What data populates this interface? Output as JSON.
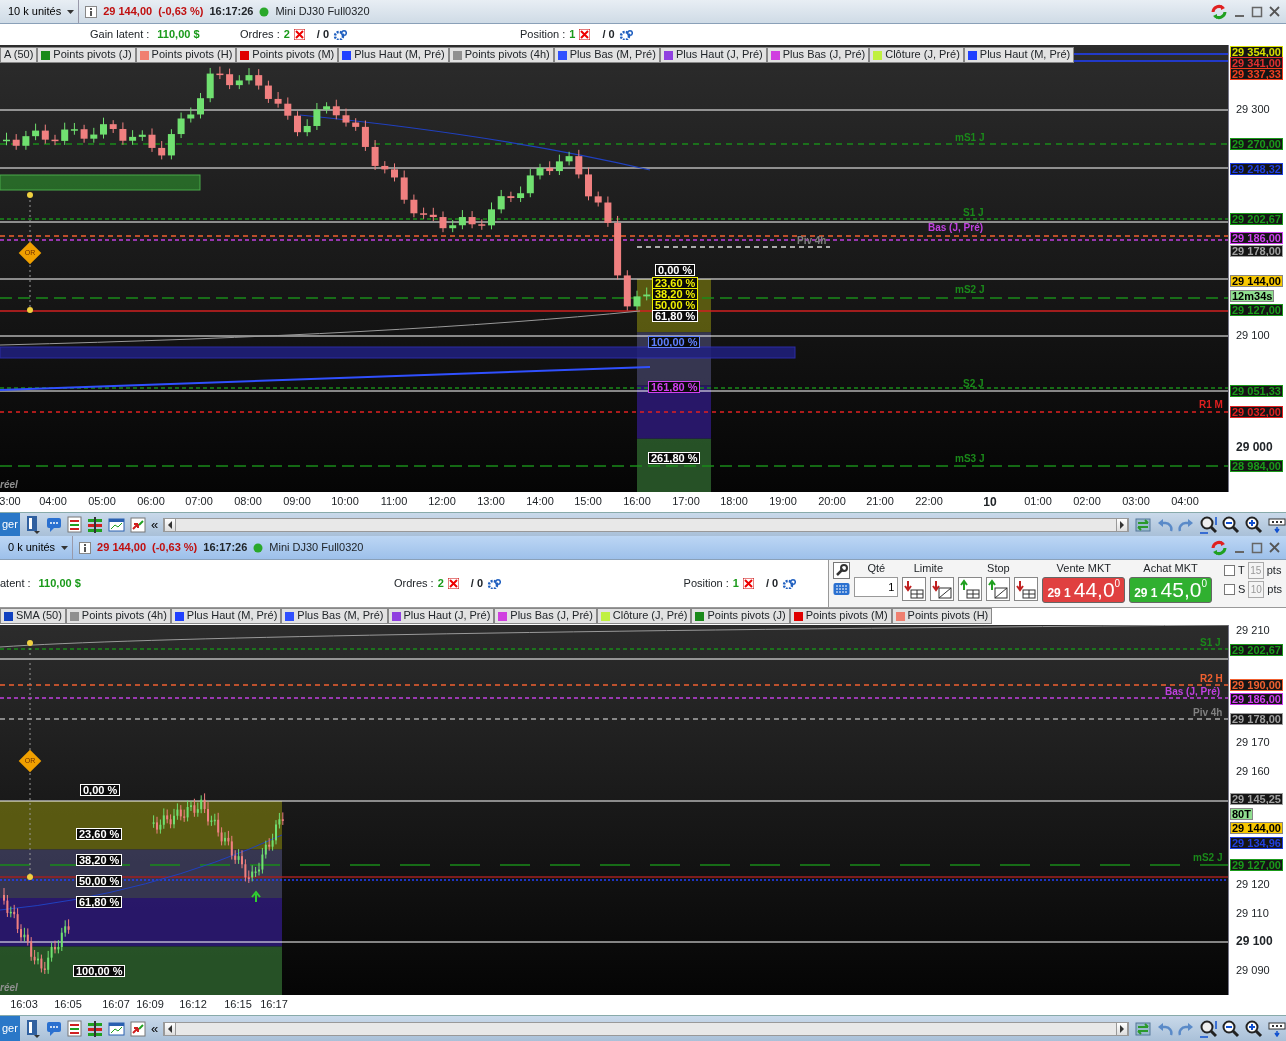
{
  "panels": [
    {
      "title_bar": {
        "units": "10 k unités",
        "price": "29 144,00",
        "change": "(-0,63 %)",
        "time": "16:17:26",
        "instrument": "Mini DJ30 Full0320"
      },
      "info": {
        "gain_label": "Gain latent :",
        "gain_value": "110,00 $",
        "orders_label": "Ordres :",
        "orders_count": "2",
        "orders_pending": "/ 0",
        "position_label": "Position :",
        "position_count": "1",
        "position_pending": "/ 0"
      },
      "legend": [
        {
          "label": "A (50)"
        },
        {
          "label": "Points pivots (J)",
          "color": "#1a8a1a"
        },
        {
          "label": "Points pivots (H)",
          "color": "#f08070"
        },
        {
          "label": "Points pivots (M)",
          "color": "#e00000"
        },
        {
          "label": "Plus Haut (M, Pré)",
          "color": "#2040ff"
        },
        {
          "label": "Points pivots (4h)",
          "color": "#909090"
        },
        {
          "label": "Plus Bas (M, Pré)",
          "color": "#3050ff"
        },
        {
          "label": "Plus Haut (J, Pré)",
          "color": "#9040e0"
        },
        {
          "label": "Plus Bas (J, Pré)",
          "color": "#d040e0"
        },
        {
          "label": "Clôture (J, Pré)",
          "color": "#c0f040"
        },
        {
          "label": "Plus Haut (M, Pré)",
          "color": "#2040ff"
        }
      ],
      "axis": [
        {
          "text": "29 354,00",
          "kind": "tag",
          "color": "#d8e000"
        },
        {
          "text": "29 341,00",
          "kind": "tag",
          "color": "#e03030"
        },
        {
          "text": "29 337,33",
          "kind": "tag",
          "color": "#f04020"
        },
        {
          "text": "29 300",
          "kind": "tick"
        },
        {
          "text": "29 270,00",
          "kind": "tag",
          "color": "#1a9a1a"
        },
        {
          "text": "29 248,32",
          "kind": "tag",
          "color": "#2040e0"
        },
        {
          "text": "29 202,67",
          "kind": "tag",
          "color": "#1a9a1a"
        },
        {
          "text": "29 186,00",
          "kind": "tag",
          "color": "#d040f0"
        },
        {
          "text": "29 178,00",
          "kind": "tag",
          "color": "#a0a0a0"
        },
        {
          "text": "29 144,00",
          "kind": "price"
        },
        {
          "text": "12m34s",
          "kind": "timer"
        },
        {
          "text": "29 127,00",
          "kind": "tag",
          "color": "#1a9a1a"
        },
        {
          "text": "29 100",
          "kind": "tick"
        },
        {
          "text": "29 051,33",
          "kind": "tag",
          "color": "#1a9a1a"
        },
        {
          "text": "29 032,00",
          "kind": "tag",
          "color": "#e02020"
        },
        {
          "text": "29 000",
          "kind": "major"
        },
        {
          "text": "28 984,00",
          "kind": "tag",
          "color": "#1a9a1a"
        }
      ],
      "chart_labels": [
        {
          "text": "mS1 J",
          "color": "#1a8a1a"
        },
        {
          "text": "S1 J",
          "color": "#1a8a1a"
        },
        {
          "text": "Bas (J, Pré)",
          "color": "#c040e0"
        },
        {
          "text": "Piv 4h",
          "color": "#808080"
        },
        {
          "text": "mS2 J",
          "color": "#1a8a1a"
        },
        {
          "text": "S2 J",
          "color": "#1a8a1a"
        },
        {
          "text": "R1 M",
          "color": "#e02020"
        },
        {
          "text": "mS3 J",
          "color": "#1a8a1a"
        },
        {
          "text": "réel",
          "color": "#909090"
        }
      ],
      "marker": "OR",
      "fib": [
        {
          "text": "0,00 %",
          "color": "#ffffff"
        },
        {
          "text": "23,60 %",
          "color": "#f0f000"
        },
        {
          "text": "38,20 %",
          "color": "#f0f000"
        },
        {
          "text": "50,00 %",
          "color": "#f0f000"
        },
        {
          "text": "61,80 %",
          "color": "#ffffff"
        },
        {
          "text": "100,00 %",
          "color": "#6080ff"
        },
        {
          "text": "161,80 %",
          "color": "#d040f0"
        },
        {
          "text": "261,80 %",
          "color": "#ffffff"
        }
      ],
      "times": [
        {
          "text": "3:00"
        },
        {
          "text": "04:00"
        },
        {
          "text": "05:00"
        },
        {
          "text": "06:00"
        },
        {
          "text": "07:00"
        },
        {
          "text": "08:00"
        },
        {
          "text": "09:00"
        },
        {
          "text": "10:00"
        },
        {
          "text": "11:00"
        },
        {
          "text": "12:00"
        },
        {
          "text": "13:00"
        },
        {
          "text": "14:00"
        },
        {
          "text": "15:00"
        },
        {
          "text": "16:00"
        },
        {
          "text": "17:00"
        },
        {
          "text": "18:00"
        },
        {
          "text": "19:00"
        },
        {
          "text": "20:00"
        },
        {
          "text": "21:00"
        },
        {
          "text": "22:00"
        },
        {
          "text": "10",
          "bold": true
        },
        {
          "text": "01:00"
        },
        {
          "text": "02:00"
        },
        {
          "text": "03:00"
        },
        {
          "text": "04:00"
        }
      ],
      "toolbar": {
        "cut_label": "ger",
        "collapse": "«"
      }
    },
    {
      "title_bar": {
        "units": "0 k unités",
        "price": "29 144,00",
        "change": "(-0,63 %)",
        "time": "16:17:26",
        "instrument": "Mini DJ30 Full0320"
      },
      "info": {
        "gain_label": "atent :",
        "gain_value": "110,00 $",
        "orders_label": "Ordres :",
        "orders_count": "2",
        "orders_pending": "/ 0",
        "position_label": "Position :",
        "position_count": "1",
        "position_pending": "/ 0"
      },
      "order_ticket": {
        "qty_label": "Qté",
        "qty": "1",
        "limit_label": "Limite",
        "stop_label": "Stop",
        "sell_label": "Vente MKT",
        "sell_prefix": "29 1",
        "sell_big": "44,0",
        "sell_sup": "0",
        "buy_label": "Achat MKT",
        "buy_prefix": "29 1",
        "buy_big": "45,0",
        "buy_sup": "0",
        "options": [
          {
            "letter": "T",
            "value": "15",
            "unit": "pts",
            "checked": false
          },
          {
            "letter": "S",
            "value": "10",
            "unit": "pts",
            "checked": false
          }
        ]
      },
      "legend": [
        {
          "label": "SMA (50)",
          "color": "#1040c0"
        },
        {
          "label": "Points pivots (4h)",
          "color": "#909090"
        },
        {
          "label": "Plus Haut (M, Pré)",
          "color": "#2040ff"
        },
        {
          "label": "Plus Bas (M, Pré)",
          "color": "#3050ff"
        },
        {
          "label": "Plus Haut (J, Pré)",
          "color": "#9040e0"
        },
        {
          "label": "Plus Bas (J, Pré)",
          "color": "#d040e0"
        },
        {
          "label": "Clôture (J, Pré)",
          "color": "#c0f040"
        },
        {
          "label": "Points pivots (J)",
          "color": "#1a8a1a"
        },
        {
          "label": "Points pivots (M)",
          "color": "#e00000"
        },
        {
          "label": "Points pivots (H)",
          "color": "#f08070"
        }
      ],
      "axis": [
        {
          "text": "29 210",
          "kind": "tick"
        },
        {
          "text": "29 202,67",
          "kind": "tag",
          "color": "#1a9a1a"
        },
        {
          "text": "29 190,00",
          "kind": "tag",
          "color": "#f06030"
        },
        {
          "text": "29 186,00",
          "kind": "tag",
          "color": "#d040f0"
        },
        {
          "text": "29 178,00",
          "kind": "tag",
          "color": "#a0a0a0"
        },
        {
          "text": "29 170",
          "kind": "tick"
        },
        {
          "text": "29 160",
          "kind": "tick"
        },
        {
          "text": "29 145,25",
          "kind": "tag",
          "color": "#a0a0a0"
        },
        {
          "text": "80T",
          "kind": "timer"
        },
        {
          "text": "29 144,00",
          "kind": "price"
        },
        {
          "text": "29 134,96",
          "kind": "tag",
          "color": "#2040e0"
        },
        {
          "text": "29 127,00",
          "kind": "tag",
          "color": "#1a9a1a"
        },
        {
          "text": "29 120",
          "kind": "tick"
        },
        {
          "text": "29 110",
          "kind": "tick"
        },
        {
          "text": "29 100",
          "kind": "major"
        },
        {
          "text": "29 090",
          "kind": "tick"
        }
      ],
      "chart_labels": [
        {
          "text": "S1 J",
          "color": "#1a8a1a"
        },
        {
          "text": "R2 H",
          "color": "#f06030"
        },
        {
          "text": "Bas (J, Pré)",
          "color": "#c040e0"
        },
        {
          "text": "Piv 4h",
          "color": "#808080"
        },
        {
          "text": "mS2 J",
          "color": "#1a8a1a"
        },
        {
          "text": "réel",
          "color": "#909090"
        }
      ],
      "marker": "OR",
      "fib": [
        {
          "text": "0,00 %",
          "color": "#ffffff"
        },
        {
          "text": "23,60 %",
          "color": "#ffffff"
        },
        {
          "text": "38,20 %",
          "color": "#ffffff"
        },
        {
          "text": "50,00 %",
          "color": "#ffffff"
        },
        {
          "text": "61,80 %",
          "color": "#ffffff"
        },
        {
          "text": "100,00 %",
          "color": "#ffffff"
        }
      ],
      "times": [
        {
          "text": "16:03"
        },
        {
          "text": "16:05"
        },
        {
          "text": "16:07"
        },
        {
          "text": "16:09"
        },
        {
          "text": "16:12"
        },
        {
          "text": "16:15"
        },
        {
          "text": "16:17"
        }
      ],
      "toolbar": {
        "cut_label": "ger",
        "collapse": "«"
      }
    }
  ]
}
